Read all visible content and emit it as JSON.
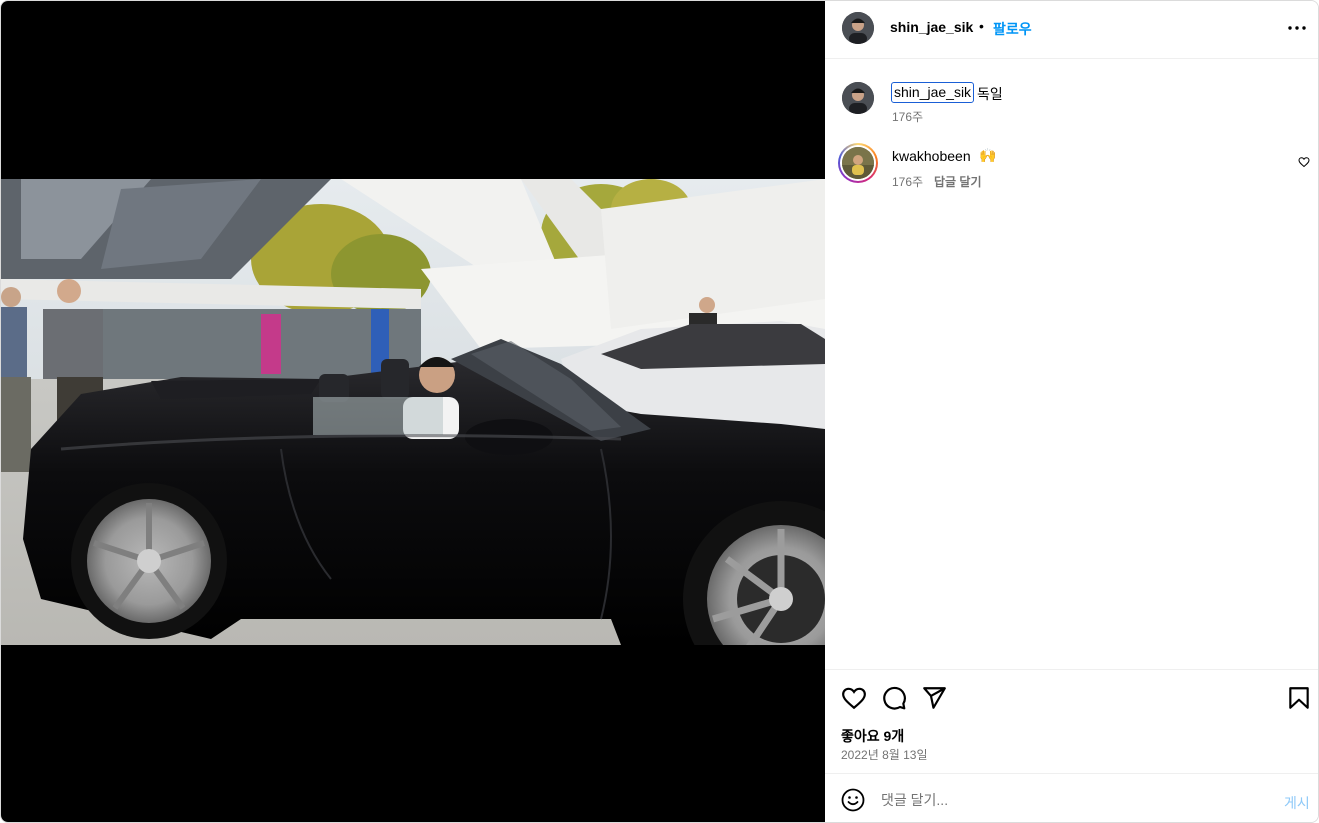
{
  "colors": {
    "link": "#0095f6",
    "muted": "#737373",
    "post_disabled": "#8ec9f8",
    "border": "#efefef"
  },
  "media": {
    "type": "photo"
  },
  "header": {
    "username": "shin_jae_sik",
    "separator": "•",
    "follow_label": "팔로우",
    "more_icon": "more-horizontal-icon"
  },
  "caption": {
    "username": "shin_jae_sik",
    "text": "독일",
    "time": "176주"
  },
  "comments": [
    {
      "username": "kwakhobeen",
      "text": "🙌",
      "time": "176주",
      "reply_label": "답글 달기",
      "like_icon": "heart-outline-icon"
    }
  ],
  "actions": {
    "icons": [
      "heart-outline-icon",
      "comment-icon",
      "share-icon",
      "bookmark-icon"
    ]
  },
  "likes_text": "좋아요 9개",
  "date": "2022년 8월 13일",
  "composer": {
    "placeholder": "댓글 달기...",
    "post_label": "게시",
    "emoji_icon": "emoji-icon"
  }
}
